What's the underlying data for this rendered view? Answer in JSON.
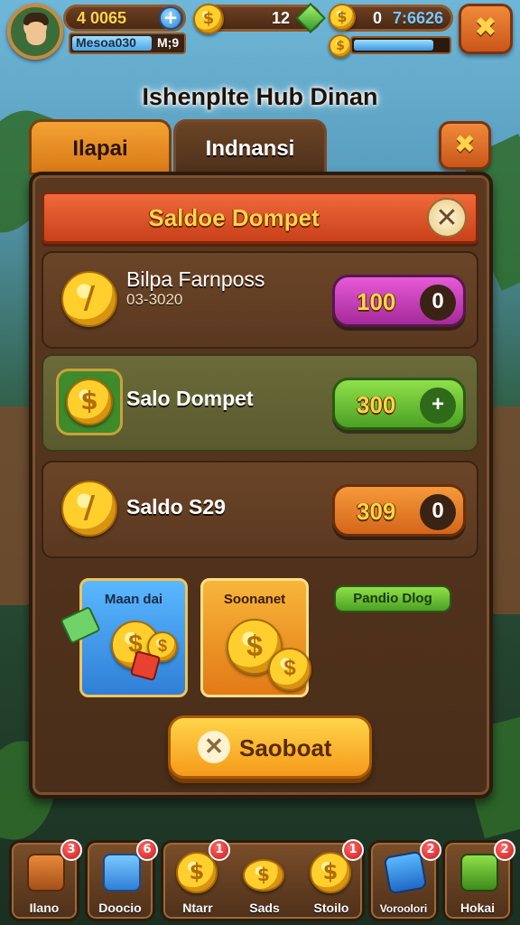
{
  "hud": {
    "currency_1": "4 0065",
    "player_name_left": "Mesoa030",
    "player_name_right": "M;9",
    "currency_2": "12",
    "currency_3": "0",
    "currency_3_extra": "7:6626",
    "xp_progress": 0.85,
    "avatar_icon": "player-avatar",
    "close_label": "✖"
  },
  "hub_title": "Ishenplte Hub Dinan",
  "tabs": [
    {
      "label": "Ilapai",
      "active": true
    },
    {
      "label": "Indnansi",
      "active": false
    }
  ],
  "panel_close": "✖",
  "banner": {
    "title": "Saldoe Dompet",
    "icon": "close-icon"
  },
  "rows": [
    {
      "title": "Bilpa Farnposs",
      "subtitle": "03-3020",
      "value": "100",
      "cap": "0",
      "color": "purple",
      "icon": "coin-icon"
    },
    {
      "title": "Salo Dompet",
      "subtitle": "",
      "value": "300",
      "cap": "+",
      "color": "green",
      "icon": "coin-badge-icon"
    },
    {
      "title": "Saldo S29",
      "subtitle": "",
      "value": "309",
      "cap": "0",
      "color": "orange",
      "icon": "coin-icon"
    }
  ],
  "cards": [
    {
      "title": "Maan dai",
      "color": "blue",
      "icon": "coin-stack-icon"
    },
    {
      "title": "Soonanet",
      "color": "orange",
      "icon": "coin-pair-icon"
    }
  ],
  "pill": "Pandio Dlog",
  "main_button": "Saoboat",
  "nav": [
    {
      "label": "Ilano",
      "badge": "3",
      "icon": "chest-icon"
    },
    {
      "label": "Doocio",
      "badge": "6",
      "icon": "box-icon"
    },
    {
      "label": "Ntarr",
      "badge": "1",
      "icon": "coin-icon"
    },
    {
      "label": "Sads",
      "badge": "",
      "icon": "coins-icon"
    },
    {
      "label": "Stoilo",
      "badge": "1",
      "icon": "coin-sword-icon"
    },
    {
      "label": "Voroolori",
      "badge": "2",
      "icon": "map-icon"
    },
    {
      "label": "Hokai",
      "badge": "2",
      "icon": "cash-icon"
    }
  ],
  "colors": {
    "accent_orange": "#f3a233",
    "panel_brown": "#5a3820",
    "gold": "#ffd54a",
    "purple": "#e65ad6",
    "green": "#8fe04a"
  }
}
